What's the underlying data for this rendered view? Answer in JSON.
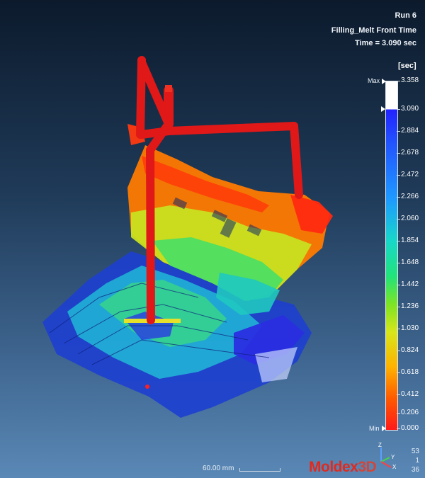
{
  "header": {
    "run": "Run 6",
    "result_name": "Filling_Melt Front Time",
    "time": "Time = 3.090 sec"
  },
  "legend": {
    "unit": "[sec]",
    "max_label": "Max",
    "min_label": "Min",
    "values": [
      "3.358",
      "3.090",
      "2.884",
      "2.678",
      "2.472",
      "2.266",
      "2.060",
      "1.854",
      "1.648",
      "1.442",
      "1.236",
      "1.030",
      "0.824",
      "0.618",
      "0.412",
      "0.206",
      "0.000"
    ],
    "current_value": "3.090",
    "colors": [
      "#ff1a1a",
      "#ff5a00",
      "#ffb200",
      "#d8e61a",
      "#7de425",
      "#22e37a",
      "#18d8c8",
      "#1e9bff",
      "#2255ff",
      "#2222ff",
      "#ffffff"
    ]
  },
  "footer": {
    "scale": "60.00 mm",
    "logo_main": "Moldex",
    "logo_suffix": "3D",
    "frame_numbers": [
      "53",
      "1",
      "36"
    ],
    "triad_axes": [
      "Z",
      "Y",
      "X"
    ]
  }
}
